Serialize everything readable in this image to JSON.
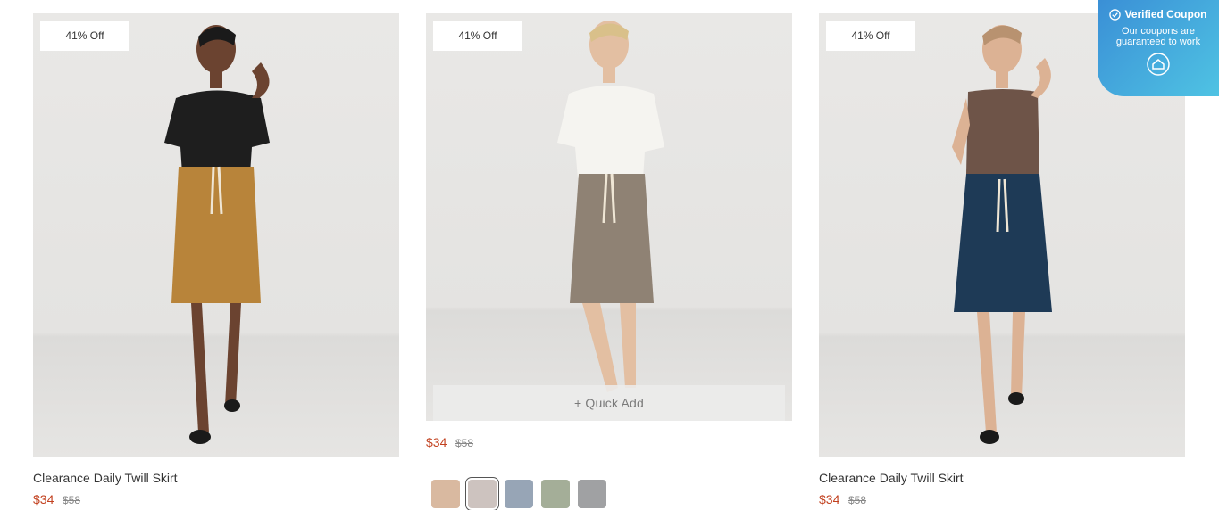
{
  "products": [
    {
      "badge": "41% Off",
      "title": "Clearance Daily Twill Skirt",
      "price": "$34",
      "original_price": "$58",
      "top_color": "#1e1e1e",
      "skirt_color": "#b8843a",
      "skin": "#6b4330"
    },
    {
      "badge": "41% Off",
      "quick_add": "+ Quick Add",
      "price": "$34",
      "original_price": "$58",
      "top_color": "#f5f4f0",
      "skirt_color": "#8f8274",
      "skin": "#e3bfa2",
      "swatches": [
        {
          "color": "#d9b9a0",
          "name": "tan"
        },
        {
          "color": "#cdc3bf",
          "name": "stone",
          "selected": true
        },
        {
          "color": "#97a5b6",
          "name": "blue-grey"
        },
        {
          "color": "#a4ae98",
          "name": "sage"
        },
        {
          "color": "#a0a1a3",
          "name": "grey"
        }
      ]
    },
    {
      "badge": "41% Off",
      "title": "Clearance Daily Twill Skirt",
      "price": "$34",
      "original_price": "$58",
      "top_color": "#6e5448",
      "skirt_color": "#1e3a56",
      "skin": "#dcb294"
    }
  ],
  "coupon": {
    "title": "Verified Coupon",
    "subtitle": "Our coupons are guaranteed to work",
    "icon": "house-logo-icon"
  }
}
